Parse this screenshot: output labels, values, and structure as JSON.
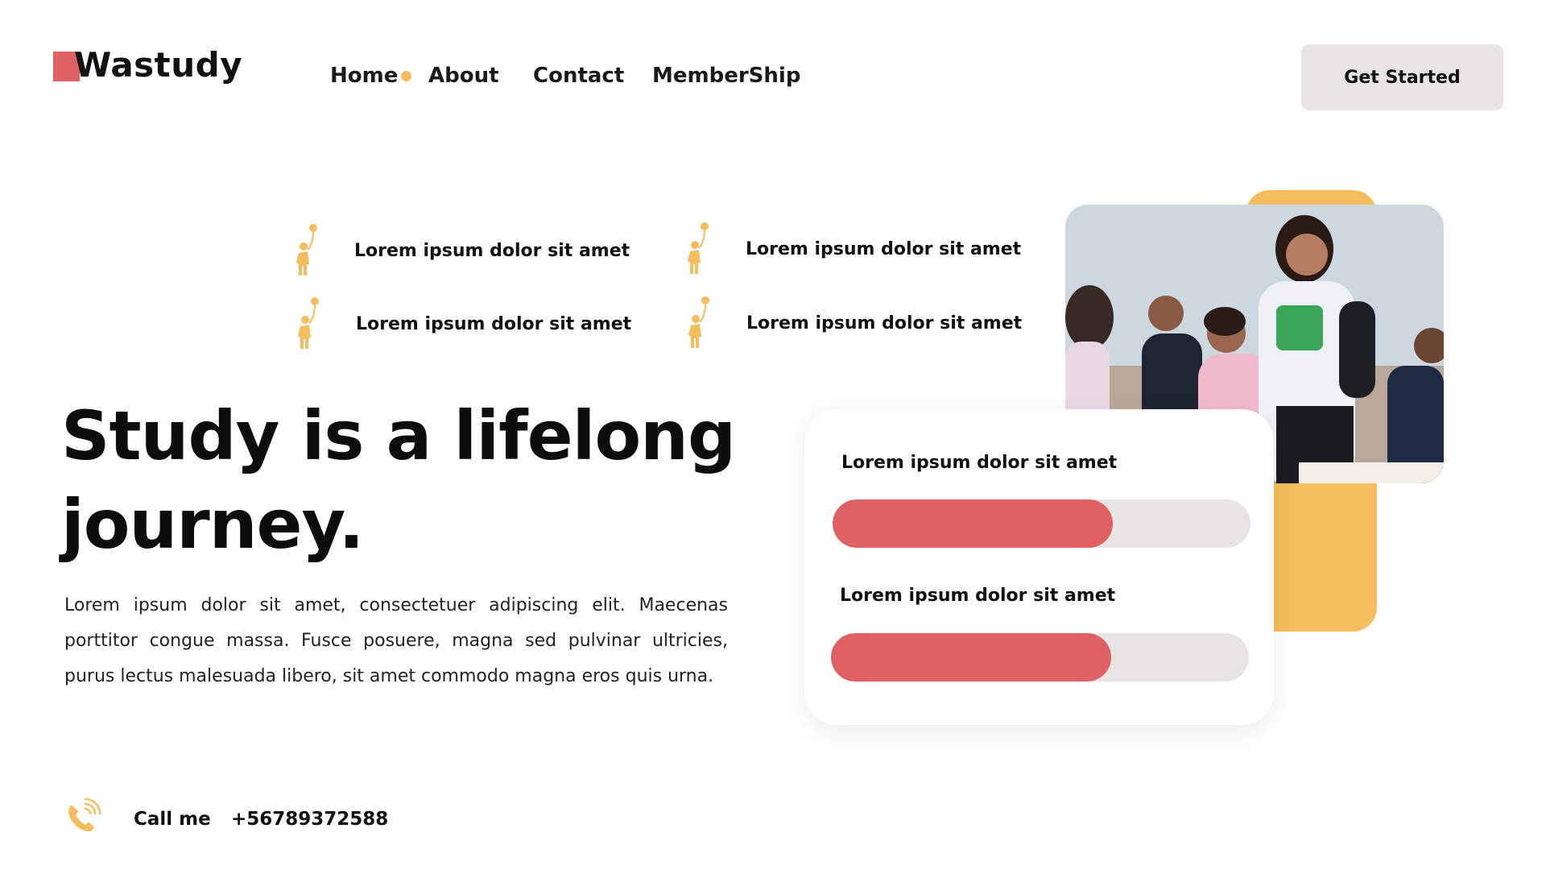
{
  "brand": {
    "name": "Wastudy",
    "accent": "#e06163",
    "secondary": "#f5bd5d"
  },
  "nav": {
    "items": [
      {
        "label": "Home"
      },
      {
        "label": "About"
      },
      {
        "label": "Contact"
      },
      {
        "label": "MemberShip"
      }
    ]
  },
  "header": {
    "cta_label": "Get Started"
  },
  "features": [
    {
      "label": "Lorem ipsum dolor sit amet",
      "icon": "person-balloon-icon"
    },
    {
      "label": "Lorem ipsum dolor sit amet",
      "icon": "person-balloon-icon"
    },
    {
      "label": "Lorem ipsum dolor sit amet",
      "icon": "person-balloon-icon"
    },
    {
      "label": "Lorem ipsum dolor sit amet",
      "icon": "person-balloon-icon"
    }
  ],
  "hero": {
    "title_line1": "Study is a lifelong",
    "title_line2": "journey.",
    "description": "Lorem ipsum dolor sit amet, consectetuer adipiscing elit. Maecenas porttitor congue massa. Fusce posuere, magna sed pulvinar ultricies, purus lectus malesuada libero, sit amet commodo magna eros quis urna."
  },
  "progress_card": {
    "items": [
      {
        "label": "Lorem ipsum dolor sit amet",
        "progress": 0.67
      },
      {
        "label": "Lorem ipsum dolor sit amet",
        "progress": 0.67
      }
    ]
  },
  "contact": {
    "label": "Call me",
    "phone": "+56789372588",
    "icon": "phone-icon"
  }
}
